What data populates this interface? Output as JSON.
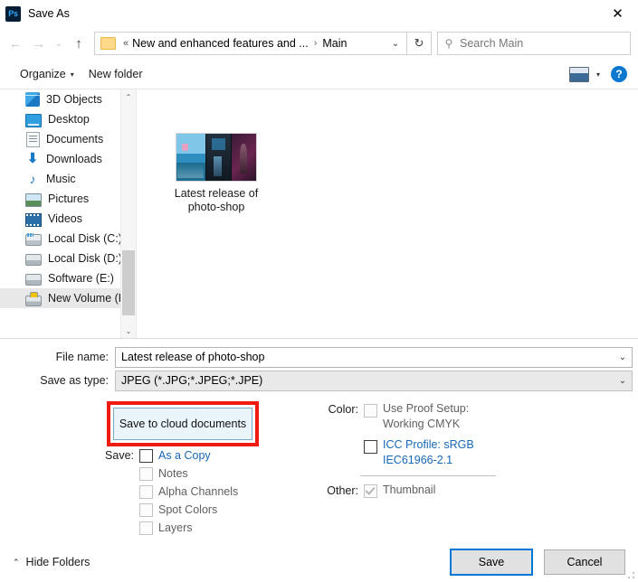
{
  "window": {
    "app_icon": "photoshop-icon",
    "app_icon_text": "Ps",
    "title": "Save As",
    "close_label": "✕"
  },
  "nav": {
    "back_icon": "←",
    "forward_icon": "→",
    "recent_icon": "⌄",
    "up_icon": "↑",
    "refresh_icon": "↻",
    "address": {
      "folder_icon": "folder-icon",
      "overflow": "«",
      "crumb_1": "New and enhanced features and ...",
      "separator": "›",
      "crumb_2": "Main",
      "dropdown_icon": "⌄"
    },
    "search": {
      "icon": "search-icon",
      "placeholder": "Search Main",
      "value": ""
    }
  },
  "commandbar": {
    "organize": "Organize",
    "organize_caret": "▾",
    "new_folder": "New folder",
    "view_icon": "view-mode-icon",
    "view_caret": "▾",
    "help_label": "?"
  },
  "sidebar": {
    "items": [
      {
        "label": "3D Objects",
        "icon": "cube-icon",
        "icon_class": "ico-3d",
        "glyph": "",
        "selected": false
      },
      {
        "label": "Desktop",
        "icon": "desktop-icon",
        "icon_class": "ico-desktop",
        "glyph": "",
        "selected": false
      },
      {
        "label": "Documents",
        "icon": "documents-icon",
        "icon_class": "ico-docs",
        "glyph": "",
        "selected": false
      },
      {
        "label": "Downloads",
        "icon": "download-arrow-icon",
        "icon_class": "ico-down",
        "glyph": "⬇",
        "selected": false
      },
      {
        "label": "Music",
        "icon": "music-note-icon",
        "icon_class": "ico-music",
        "glyph": "♪",
        "selected": false
      },
      {
        "label": "Pictures",
        "icon": "pictures-icon",
        "icon_class": "ico-pics",
        "glyph": "",
        "selected": false
      },
      {
        "label": "Videos",
        "icon": "videos-icon",
        "icon_class": "ico-vids",
        "glyph": "",
        "selected": false
      },
      {
        "label": "Local Disk (C:)",
        "icon": "system-drive-icon",
        "icon_class": "ico-diskc",
        "glyph": "",
        "selected": false
      },
      {
        "label": "Local Disk (D:)",
        "icon": "drive-icon",
        "icon_class": "ico-disk",
        "glyph": "",
        "selected": false
      },
      {
        "label": "Software (E:)",
        "icon": "drive-icon",
        "icon_class": "ico-disk",
        "glyph": "",
        "selected": false
      },
      {
        "label": "New Volume (F:)",
        "icon": "drive-unlocked-icon",
        "icon_class": "ico-vol",
        "glyph": "",
        "selected": true
      }
    ],
    "scroll_up_icon": "⌃",
    "scroll_down_icon": "⌄"
  },
  "file_list": {
    "items": [
      {
        "name": "Latest release of\nphoto-shop",
        "thumbnail": "photoshop-splash-thumbnail"
      }
    ]
  },
  "form": {
    "filename_label": "File name:",
    "filename_value": "Latest release of photo-shop",
    "savetype_label": "Save as type:",
    "savetype_value": "JPEG (*.JPG;*.JPEG;*.JPE)",
    "caret": "⌄"
  },
  "options": {
    "cloud_button_label": "Save to cloud documents",
    "highlight_color": "#ee1b11",
    "save_prefix": "Save:",
    "save_checkboxes": [
      {
        "label": "As a Copy",
        "checked": false,
        "disabled": false,
        "link": true
      },
      {
        "label": "Notes",
        "checked": false,
        "disabled": true,
        "link": false
      },
      {
        "label": "Alpha Channels",
        "checked": false,
        "disabled": true,
        "link": false
      },
      {
        "label": "Spot Colors",
        "checked": false,
        "disabled": true,
        "link": false
      },
      {
        "label": "Layers",
        "checked": false,
        "disabled": true,
        "link": false
      }
    ],
    "color_prefix": "Color:",
    "proof_line1": "Use Proof Setup:",
    "proof_line2": "Working CMYK",
    "proof_checked": false,
    "proof_disabled": true,
    "icc_line1": "ICC Profile:  sRGB",
    "icc_line2": "IEC61966-2.1",
    "icc_checked": false,
    "other_prefix": "Other:",
    "thumbnail_label": "Thumbnail",
    "thumbnail_checked": true,
    "thumbnail_disabled": true
  },
  "footer": {
    "hide_folders_caret": "⌃",
    "hide_folders_label": "Hide Folders",
    "save_label": "Save",
    "cancel_label": "Cancel"
  }
}
